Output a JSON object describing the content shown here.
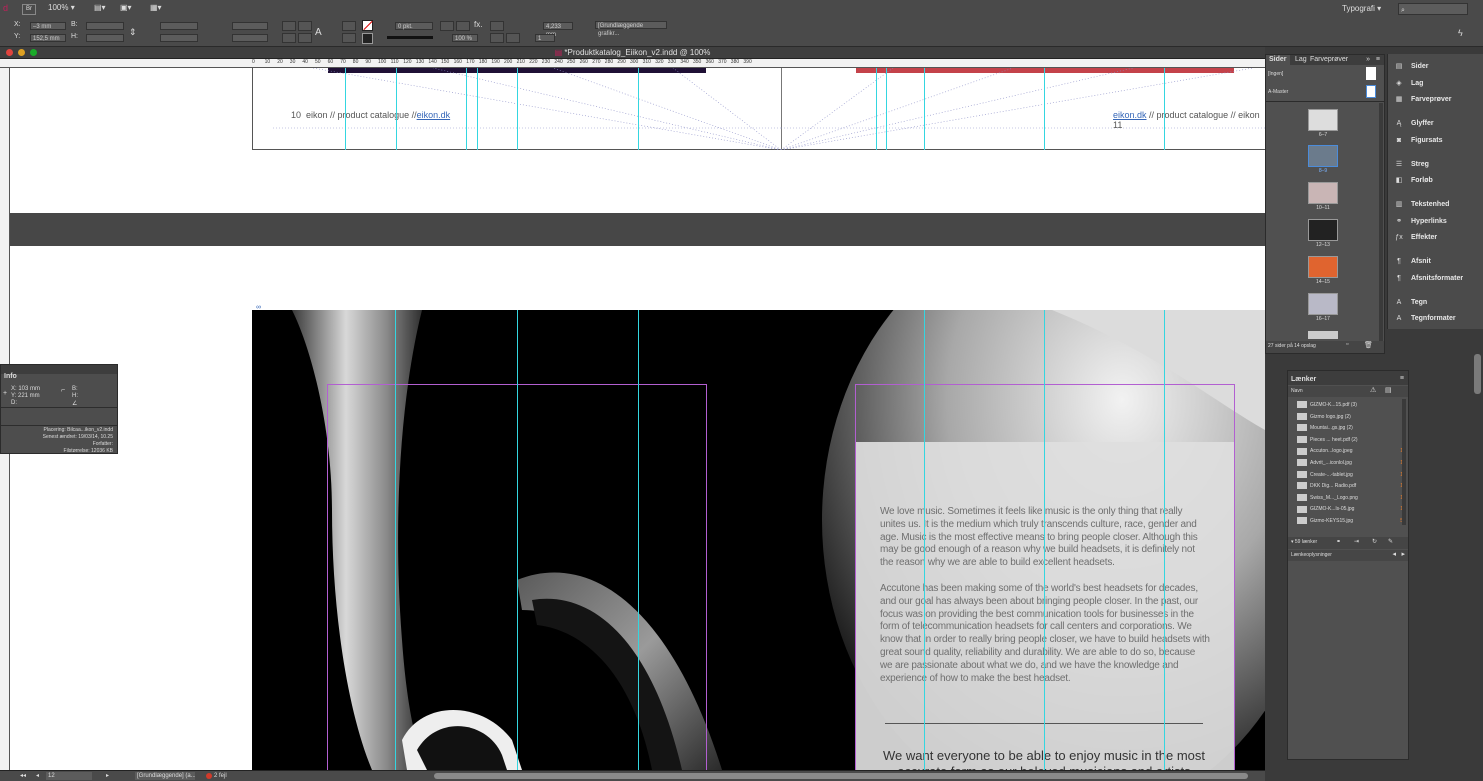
{
  "control": {
    "zoom": "100%",
    "workspace": "Typografi",
    "x_label": "X:",
    "y_label": "Y:",
    "w_label": "B:",
    "h_label": "H:",
    "x_value": "–3 mm",
    "y_value": "152,5 mm",
    "stroke_width": "0 pkt.",
    "scale": "100 %",
    "size_value": "4,233 mm",
    "object_style": "[Grundlæggende grafikr...",
    "page_field": "1"
  },
  "document": {
    "title": "*Produktkatalog_Eiikon_v2.indd @ 100%",
    "ruler_ticks": [
      "0",
      "10",
      "20",
      "30",
      "40",
      "50",
      "60",
      "70",
      "80",
      "90",
      "100",
      "110",
      "120",
      "130",
      "140",
      "150",
      "160",
      "170",
      "180",
      "190",
      "200",
      "210",
      "220",
      "230",
      "240",
      "250",
      "260",
      "270",
      "280",
      "290",
      "300",
      "310",
      "320",
      "330",
      "340",
      "350",
      "360",
      "370",
      "380",
      "390"
    ],
    "footer_left_num": "10",
    "footer_left_text": "eikon // product catalogue //",
    "footer_left_link": "eikon.dk",
    "footer_right_link": "eikon.dk",
    "footer_right_text": "// product catalogue // eikon",
    "footer_right_num": "11",
    "paragraph1": "We love music. Sometimes it feels like music is the only thing that really unites us. It is the medium which truly transcends culture, race, gender and age. Music is the most effective means to bring people closer. Although this may be good enough of a reason why we build headsets, it is definitely not the reason why we are able to build excellent headsets.",
    "paragraph2": "Accutone has been making some of the world's best headsets for decades, and our goal has always been about bringing people closer. In the past, our focus was on providing the best communication tools for businesses in the form of telecommunication headsets for call centers and corporations. We know that in order to really bring people closer, we have to build headsets with great sound quality, reliability and durability. We are able to do so, because we are passionate about what we do, and we have the knowledge and experience of how to make the best headset.",
    "heading": "We want everyone to be able to enjoy music in the most accurate form as our beloved musicians and artists"
  },
  "pages_panel": {
    "tabs": [
      "Sider",
      "Lag",
      "Farveprøver"
    ],
    "none_label": "[Ingen]",
    "master_label": "A-Master",
    "thumbs": [
      "6–7",
      "8–9",
      "10–11",
      "12–13",
      "14–15",
      "16–17"
    ],
    "footer": "27 sider på 14 opslag"
  },
  "dock": {
    "items": [
      {
        "label": "Sider",
        "icon": "pages-icon"
      },
      {
        "label": "Lag",
        "icon": "layers-icon"
      },
      {
        "label": "Farveprøver",
        "icon": "swatches-icon"
      },
      {
        "label": "Glyffer",
        "icon": "glyphs-icon"
      },
      {
        "label": "Figursats",
        "icon": "text-wrap-icon"
      },
      {
        "label": "Streg",
        "icon": "stroke-icon"
      },
      {
        "label": "Forløb",
        "icon": "gradient-icon"
      },
      {
        "label": "Tekstenhed",
        "icon": "text-frame-icon"
      },
      {
        "label": "Hyperlinks",
        "icon": "hyperlinks-icon"
      },
      {
        "label": "Effekter",
        "icon": "effects-icon"
      },
      {
        "label": "Afsnit",
        "icon": "paragraph-icon"
      },
      {
        "label": "Afsnitsformater",
        "icon": "paragraph-styles-icon"
      },
      {
        "label": "Tegn",
        "icon": "character-icon"
      },
      {
        "label": "Tegnformater",
        "icon": "character-styles-icon"
      }
    ]
  },
  "info_panel": {
    "title": "Info",
    "x": "X: 103 mm",
    "y": "Y: 221 mm",
    "d": "D:",
    "b": "B:",
    "h": "H:",
    "placering": "Placering: Bilcaa...ikon_v2.indd",
    "senest": "Senest ændret: 19/03/14, 10.25",
    "forfatter": "Forfatter:",
    "filstorrelse": "Filstørrelse: 12036 KB"
  },
  "links_panel": {
    "title": "Lænker",
    "col_name": "Navn",
    "rows": [
      {
        "name": "GIZMO-K...15.pdf (3)",
        "num": ""
      },
      {
        "name": "Gizmo logo.jpg (2)",
        "num": ""
      },
      {
        "name": "Mountai...gs.jpg (2)",
        "num": ""
      },
      {
        "name": "Pieces ... heet.pdf (2)",
        "num": ""
      },
      {
        "name": "Accuton...logo.jpeg",
        "num": "1"
      },
      {
        "name": "Advrit_...iconlol.jpg",
        "num": "1"
      },
      {
        "name": "Create-...-tablet.jpg",
        "num": "1"
      },
      {
        "name": "DKK Dig... Radio.pdf",
        "num": "1"
      },
      {
        "name": "Swiss_M..._Logo.png",
        "num": "1"
      },
      {
        "name": "GIZMO-K...ls-05.jpg",
        "num": "1"
      },
      {
        "name": "Gizmo-KEYS15.jpg",
        "num": "5"
      }
    ],
    "count": "59 lænker",
    "info_header": "Lænkeoplysninger"
  },
  "status": {
    "page": "12",
    "style": "[Grundlæggende] (a...",
    "errors": "2 fejl"
  }
}
